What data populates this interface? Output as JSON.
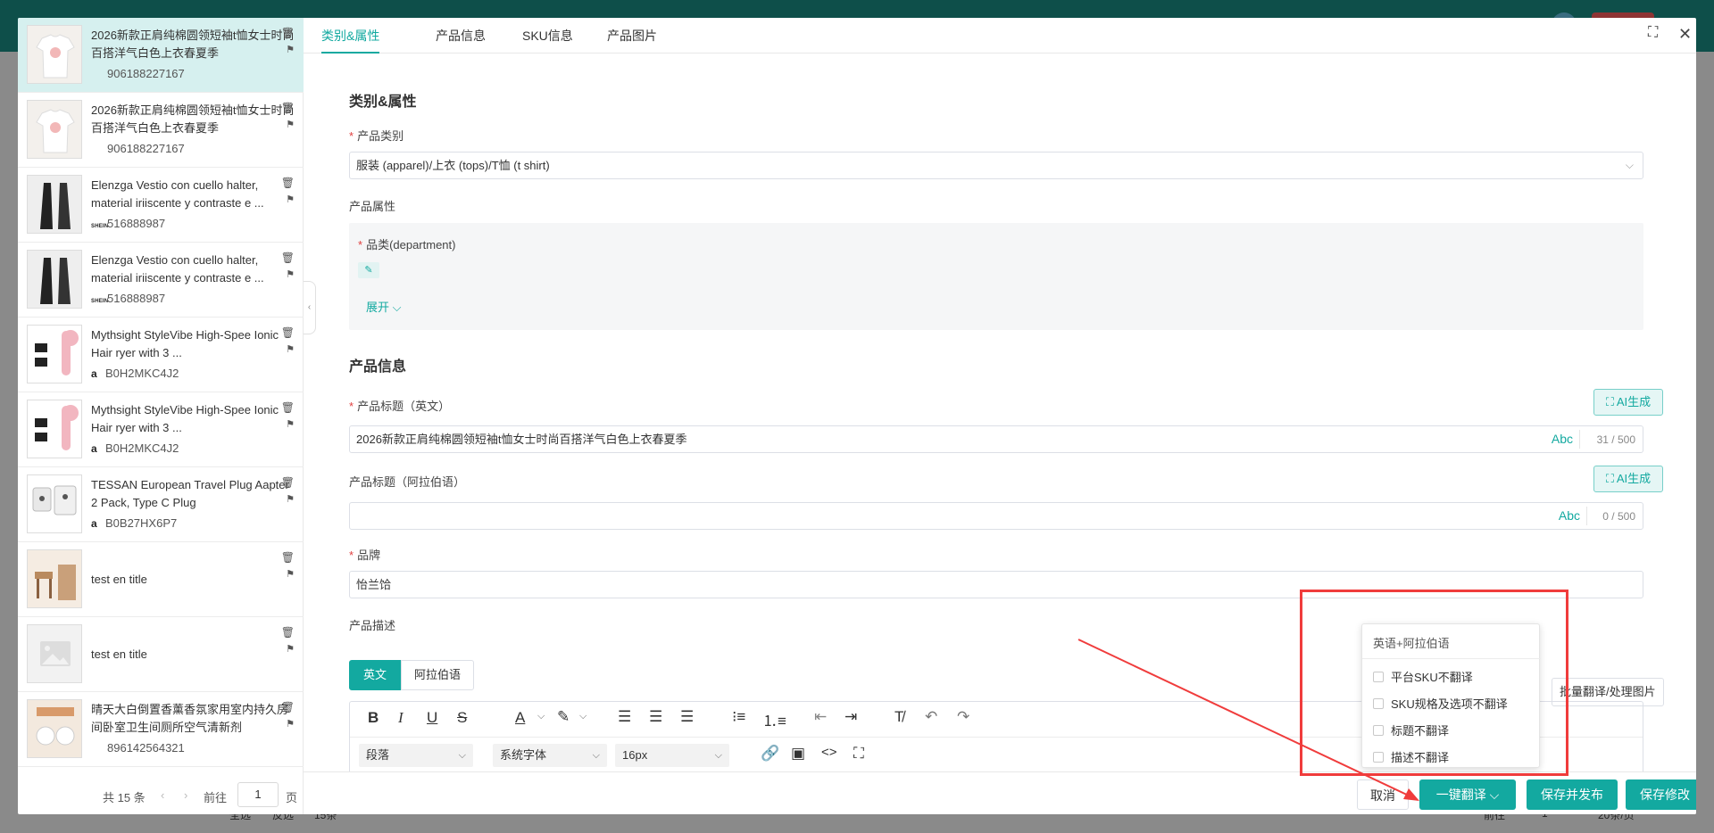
{
  "tabs": [
    {
      "label": "类别&属性"
    },
    {
      "label": "产品信息"
    },
    {
      "label": "SKU信息"
    },
    {
      "label": "产品图片"
    }
  ],
  "products": [
    {
      "title": "2026新款正肩纯棉圆领短袖t恤女士时尚百搭洋气白色上衣春夏季",
      "id": "906188227167",
      "source": ""
    },
    {
      "title": "2026新款正肩纯棉圆领短袖t恤女士时尚百搭洋气白色上衣春夏季",
      "id": "906188227167",
      "source": ""
    },
    {
      "title": "Elenzga Vestio con cuello halter, material iriiscente y contraste e ...",
      "id": "516888987",
      "source": "SHEIN"
    },
    {
      "title": "Elenzga Vestio con cuello halter, material iriiscente y contraste e ...",
      "id": "516888987",
      "source": "SHEIN"
    },
    {
      "title": "Mythsight StyleVibe High-Spee Ionic Hair ryer with 3 ...",
      "id": "B0H2MKC4J2",
      "source": "a"
    },
    {
      "title": "Mythsight StyleVibe High-Spee Ionic Hair ryer with 3 ...",
      "id": "B0H2MKC4J2",
      "source": "a"
    },
    {
      "title": "TESSAN European Travel Plug Aapter 2 Pack, Type C Plug",
      "id": "B0B27HX6P7",
      "source": "a"
    },
    {
      "title": "test en title",
      "id": "",
      "source": ""
    },
    {
      "title": "test en title",
      "id": "",
      "source": ""
    },
    {
      "title": "晴天大白倒置香薰香氛家用室内持久房间卧室卫生间厕所空气清新剂",
      "id": "896142564321",
      "source": ""
    }
  ],
  "pager": {
    "total": "共 15 条",
    "prev": "‹",
    "next": "›",
    "goto": "前往",
    "page": "1",
    "unit": "页"
  },
  "category_section": {
    "title": "类别&属性",
    "category_label": "产品类别",
    "category_value": "服装 (apparel)/上衣 (tops)/T恤 (t shirt)",
    "attr_label": "产品属性",
    "department_label": "品类(department)",
    "expand_label": "展开"
  },
  "info_section": {
    "title": "产品信息",
    "title_en_label": "产品标题（英文）",
    "title_en_value": "2026新款正肩纯棉圆领短袖t恤女士时尚百搭洋气白色上衣春夏季",
    "title_en_count": "31 / 500",
    "title_ar_label": "产品标题（阿拉伯语）",
    "title_ar_value": "",
    "title_ar_count": "0 / 500",
    "ai_label": "AI生成",
    "abc_label": "Abc",
    "brand_label": "品牌",
    "brand_value": "怡兰饸",
    "desc_label": "产品描述",
    "lang_en": "英文",
    "lang_ar": "阿拉伯语",
    "batch_label": "批量翻译/处理图片"
  },
  "editor": {
    "paragraph": "段落",
    "font": "系统字体",
    "size": "16px"
  },
  "popup": {
    "header": "英语+阿拉伯语",
    "options": [
      "平台SKU不翻译",
      "SKU规格及选项不翻译",
      "标题不翻译",
      "描述不翻译"
    ]
  },
  "footer": {
    "cancel": "取消",
    "translate": "一键翻译",
    "save_publish": "保存并发布",
    "save": "保存修改"
  },
  "background": {
    "footer_left": "全选",
    "footer_left2": "反选",
    "footer_count": "15条",
    "footer_goto": "前往",
    "footer_page": "1",
    "footer_per": "20条/页"
  },
  "colors": {
    "accent": "#13a9a0",
    "annotation": "#f03c3c"
  }
}
